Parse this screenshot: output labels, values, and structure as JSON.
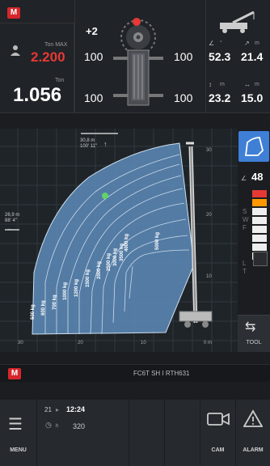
{
  "top": {
    "ton_max_label": "Ton MAX",
    "ton_max_value": "2.200",
    "ton_label": "Ton",
    "ton_value": "1.056",
    "rotation_value": "+2",
    "stab_left_top": "100",
    "stab_right_top": "100",
    "stab_left_bottom": "100",
    "stab_right_bottom": "100",
    "angle_unit": "°",
    "angle_value": "52.3",
    "length_unit": "m",
    "length_value": "21.4",
    "height_unit": "m",
    "height_value": "23.2",
    "radius_unit": "m",
    "radius_value": "15.0"
  },
  "chart": {
    "top_label_m": "30,8 m",
    "top_label_ft": "100' 11\"",
    "left_label_m": "26,9 m",
    "left_label_ft": "88' 4\"",
    "y_ticks": [
      "30",
      "20",
      "10"
    ],
    "x_ticks": [
      "30",
      "20",
      "10",
      "0 m"
    ],
    "loads": [
      "500 kg",
      "600 kg",
      "700 kg",
      "1000 kg",
      "1200 kg",
      "1500 kg",
      "2000 kg",
      "2500 kg",
      "3000 kg",
      "3500 kg",
      "4000 kg",
      "5000 kg"
    ]
  },
  "right_panel": {
    "value": "48",
    "letters": [
      "S",
      "W",
      "F",
      "L",
      "T"
    ]
  },
  "status": {
    "model": "FC6T SH I RTH631",
    "tool_label": "TOOL"
  },
  "bottom": {
    "menu_label": "MENU",
    "counter": "21",
    "time": "12:24",
    "hours": "320",
    "hours_unit": "h",
    "cam_label": "CAM",
    "alarm_label": "ALARM"
  },
  "colors": {
    "accent_red": "#e53935",
    "chart_fill": "#5f8fbf",
    "active_blue": "#3f7fd6"
  }
}
